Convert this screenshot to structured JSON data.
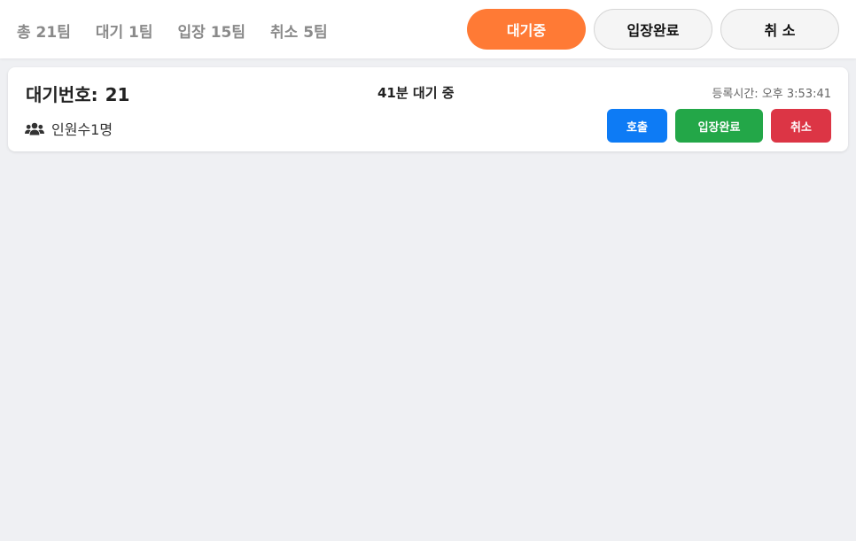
{
  "stats": {
    "total": "총 21팀",
    "waiting": "대기 1팀",
    "entered": "입장 15팀",
    "cancelled": "취소 5팀"
  },
  "tabs": {
    "waiting": "대기중",
    "entered": "입장완료",
    "cancel": "취 소"
  },
  "card": {
    "wait_label": "대기번호:",
    "wait_number": "21",
    "elapsed": "41분 대기 중",
    "registered": "등록시간: 오후 3:53:41",
    "people_icon": "users-icon",
    "people": "인원수1명",
    "buttons": {
      "call": "호출",
      "enter": "입장완료",
      "cancel": "취소"
    }
  },
  "colors": {
    "accent": "#ff7a35",
    "call": "#0d7bf5",
    "enter": "#23a748",
    "cancel": "#dc3545",
    "background": "#eff0f3"
  }
}
